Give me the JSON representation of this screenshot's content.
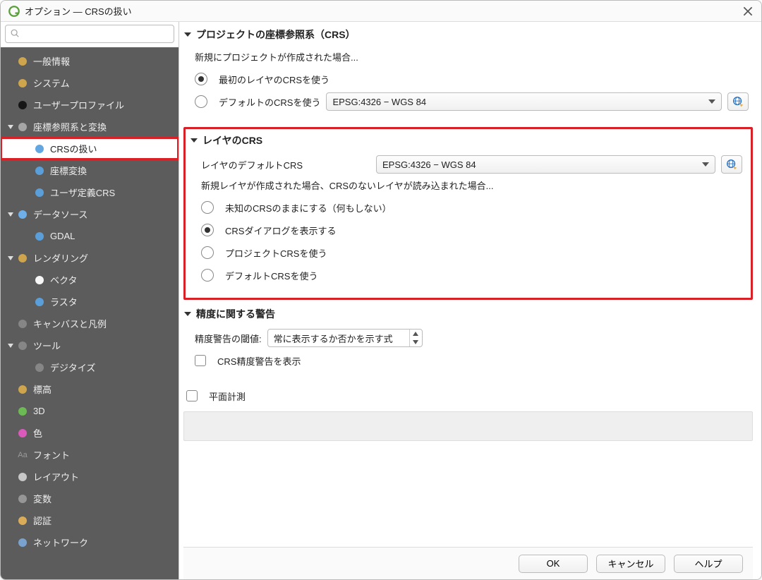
{
  "window": {
    "title": "オプション — CRSの扱い"
  },
  "search": {
    "placeholder": ""
  },
  "sidebar": {
    "items": [
      {
        "label": "一般情報",
        "level": 1,
        "expandable": false,
        "iconColor": "#d4a84b"
      },
      {
        "label": "システム",
        "level": 1,
        "expandable": false,
        "iconColor": "#d4a84b"
      },
      {
        "label": "ユーザープロファイル",
        "level": 1,
        "expandable": false,
        "iconColor": "#111"
      },
      {
        "label": "座標参照系と変換",
        "level": 1,
        "expandable": true
      },
      {
        "label": "CRSの扱い",
        "level": 2,
        "selected": true,
        "highlight": true,
        "iconColor": "#5aa2e0"
      },
      {
        "label": "座標変換",
        "level": 2,
        "iconColor": "#5aa2e0"
      },
      {
        "label": "ユーザ定義CRS",
        "level": 2,
        "iconColor": "#5aa2e0"
      },
      {
        "label": "データソース",
        "level": 1,
        "expandable": true,
        "iconColor": "#6fb2f0"
      },
      {
        "label": "GDAL",
        "level": 2,
        "iconColor": "#5aa2e0"
      },
      {
        "label": "レンダリング",
        "level": 1,
        "expandable": true,
        "iconColor": "#d4a84b"
      },
      {
        "label": "ベクタ",
        "level": 2,
        "iconColor": "#fff"
      },
      {
        "label": "ラスタ",
        "level": 2,
        "iconColor": "#5aa2e0"
      },
      {
        "label": "キャンバスと凡例",
        "level": 1,
        "iconColor": "#888"
      },
      {
        "label": "ツール",
        "level": 1,
        "expandable": true,
        "iconColor": "#888"
      },
      {
        "label": "デジタイズ",
        "level": 2,
        "iconColor": "#888"
      },
      {
        "label": "標高",
        "level": 1,
        "iconColor": "#d4a84b"
      },
      {
        "label": "3D",
        "level": 1,
        "iconColor": "#6dbf52"
      },
      {
        "label": "色",
        "level": 1,
        "iconColor": "#e05ac1"
      },
      {
        "label": "フォント",
        "level": 1,
        "iconColor": "#999",
        "iconText": "Aa"
      },
      {
        "label": "レイアウト",
        "level": 1,
        "iconColor": "#ccc"
      },
      {
        "label": "変数",
        "level": 1,
        "iconColor": "#999"
      },
      {
        "label": "認証",
        "level": 1,
        "iconColor": "#e0b05a"
      },
      {
        "label": "ネットワーク",
        "level": 1,
        "iconColor": "#7aa7d4"
      }
    ]
  },
  "groups": {
    "project_crs": {
      "title": "プロジェクトの座標参照系（CRS）",
      "subtext": "新規にプロジェクトが作成された場合...",
      "opt_first_layer": "最初のレイヤのCRSを使う",
      "opt_default_crs": "デフォルトのCRSを使う",
      "combo_value": "EPSG:4326 − WGS 84",
      "selected": "first_layer"
    },
    "layer_crs": {
      "title": "レイヤのCRS",
      "default_label": "レイヤのデフォルトCRS",
      "combo_value": "EPSG:4326 − WGS 84",
      "subtext": "新規レイヤが作成された場合、CRSのないレイヤが読み込まれた場合...",
      "opt_leave": "未知のCRSのままにする（何もしない）",
      "opt_prompt": "CRSダイアログを表示する",
      "opt_project": "プロジェクトCRSを使う",
      "opt_default": "デフォルトCRSを使う",
      "selected": "prompt"
    },
    "accuracy": {
      "title": "精度に関する警告",
      "threshold_label": "精度警告の閾値:",
      "threshold_value": "常に表示するか否かを示す式",
      "show_warnings": "CRS精度警告を表示"
    },
    "planimetric": {
      "label": "平面計測"
    }
  },
  "footer": {
    "ok": "OK",
    "cancel": "キャンセル",
    "help": "ヘルプ"
  }
}
